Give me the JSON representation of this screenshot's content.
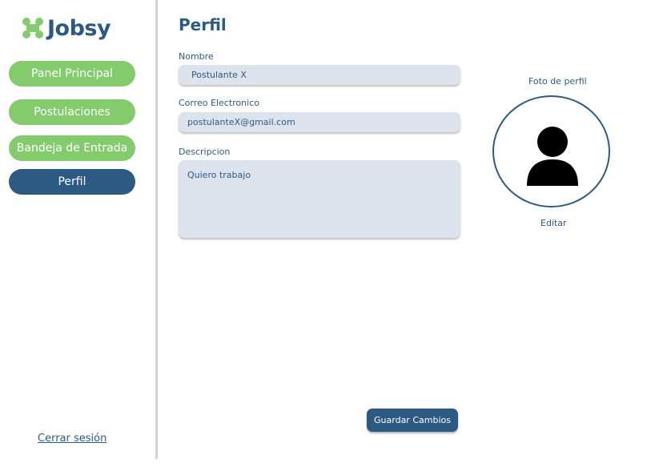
{
  "brand": {
    "name": "Jobsy",
    "logo_icon": "jobsy-logo-icon"
  },
  "sidebar": {
    "items": [
      {
        "label": "Panel Principal",
        "active": false
      },
      {
        "label": "Postulaciones",
        "active": false
      },
      {
        "label": "Bandeja de Entrada",
        "active": false
      },
      {
        "label": "Perfil",
        "active": true
      }
    ],
    "logout_label": "Cerrar sesión"
  },
  "page": {
    "title": "Perfil"
  },
  "form": {
    "name": {
      "label": "Nombre",
      "value": "Postulante X"
    },
    "email": {
      "label": "Correo Electronico",
      "value": "postulanteX@gmail.com"
    },
    "description": {
      "label": "Descripcion",
      "value": "Quiero trabajo"
    },
    "save_label": "Guardar Cambios"
  },
  "photo": {
    "caption": "Foto de perfil",
    "edit_label": "Editar",
    "icon": "user-avatar-icon"
  },
  "colors": {
    "primary": "#2d5a82",
    "accent_green": "#84cb6e",
    "field_bg": "#dde3ec"
  }
}
